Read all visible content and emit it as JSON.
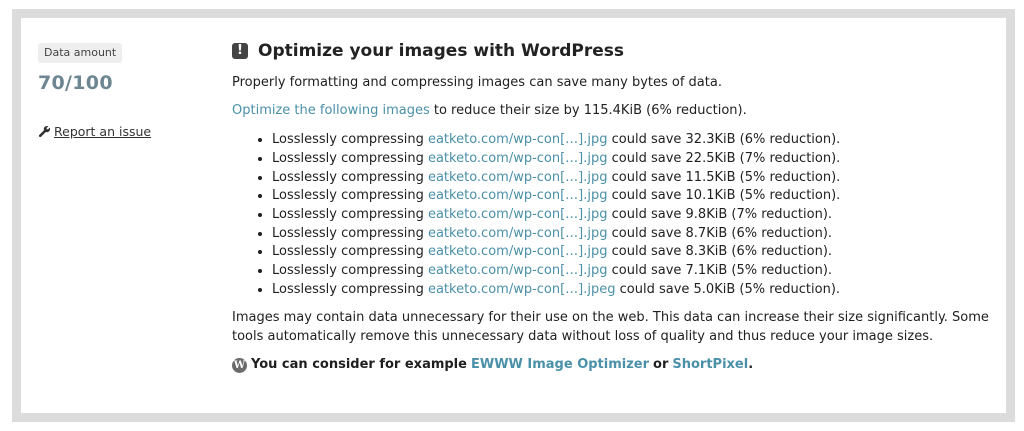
{
  "sidebar": {
    "badge_label": "Data amount",
    "score": "70/100",
    "report_label": "Report an issue"
  },
  "main": {
    "title": "Optimize your images with WordPress",
    "warning_glyph": "!",
    "intro": "Properly formatting and compressing images can save many bytes of data.",
    "summary_link": "Optimize the following images",
    "summary_rest": " to reduce their size by 115.4KiB (6% reduction).",
    "items": [
      {
        "prefix": "Losslessly compressing ",
        "link": "eatketo.com/wp-con[…].jpg",
        "suffix": " could save 32.3KiB (6% reduction)."
      },
      {
        "prefix": "Losslessly compressing ",
        "link": "eatketo.com/wp-con[…].jpg",
        "suffix": " could save 22.5KiB (7% reduction)."
      },
      {
        "prefix": "Losslessly compressing ",
        "link": "eatketo.com/wp-con[…].jpg",
        "suffix": " could save 11.5KiB (5% reduction)."
      },
      {
        "prefix": "Losslessly compressing ",
        "link": "eatketo.com/wp-con[…].jpg",
        "suffix": " could save 10.1KiB (5% reduction)."
      },
      {
        "prefix": "Losslessly compressing ",
        "link": "eatketo.com/wp-con[…].jpg",
        "suffix": " could save 9.8KiB (7% reduction)."
      },
      {
        "prefix": "Losslessly compressing ",
        "link": "eatketo.com/wp-con[…].jpg",
        "suffix": " could save 8.7KiB (6% reduction)."
      },
      {
        "prefix": "Losslessly compressing ",
        "link": "eatketo.com/wp-con[…].jpg",
        "suffix": " could save 8.3KiB (6% reduction)."
      },
      {
        "prefix": "Losslessly compressing ",
        "link": "eatketo.com/wp-con[…].jpg",
        "suffix": " could save 7.1KiB (5% reduction)."
      },
      {
        "prefix": "Losslessly compressing ",
        "link": "eatketo.com/wp-con[…].jpeg",
        "suffix": " could save 5.0KiB (5% reduction)."
      }
    ],
    "note": "Images may contain data unnecessary for their use on the web. This data can increase their size significantly. Some tools automatically remove this unnecessary data without loss of quality and thus reduce your image sizes.",
    "consider": {
      "wp_glyph": "W",
      "text": "You can consider for example",
      "link1": "EWWW Image Optimizer",
      "or": "or",
      "link2": "ShortPixel",
      "end": "."
    }
  },
  "colors": {
    "link": "#4a90a8",
    "score": "#6d8691",
    "frame": "#dcdcdc",
    "badge_bg": "#eeeeee"
  },
  "icons": [
    "wrench-icon",
    "warning-icon",
    "wordpress-icon"
  ]
}
